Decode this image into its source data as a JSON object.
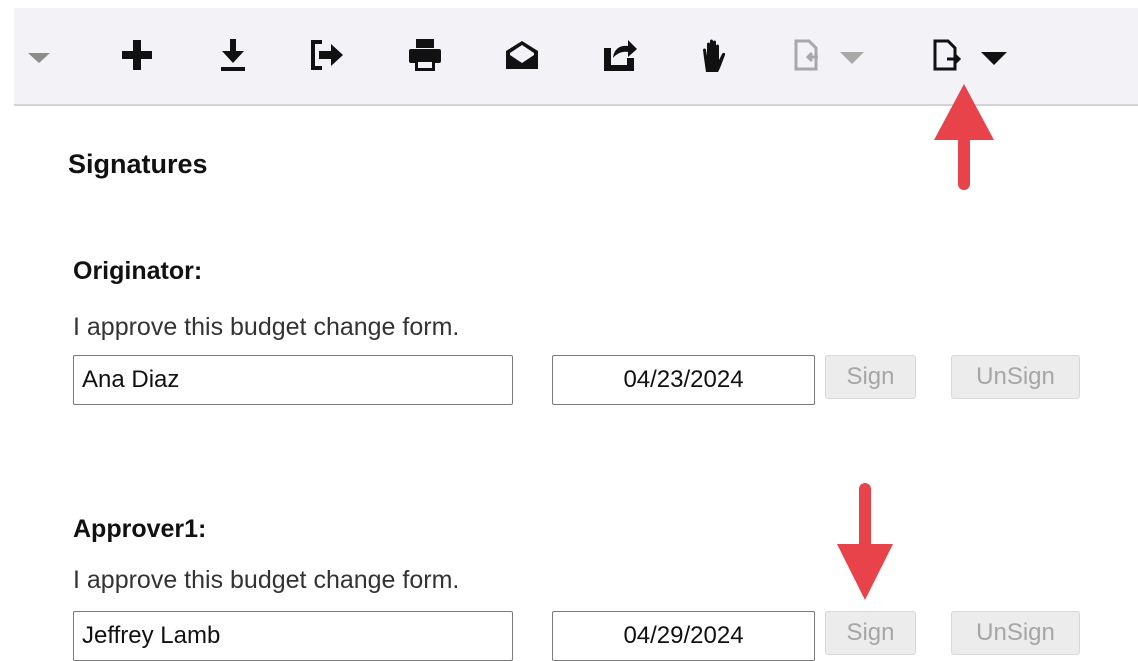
{
  "toolbar": {
    "icons": [
      "caret-down-icon",
      "add-icon",
      "download-icon",
      "export-icon",
      "print-icon",
      "email-icon",
      "reload-icon",
      "hand-icon",
      "attach-dropdown-icon",
      "document-export-dropdown-icon"
    ]
  },
  "signatures": {
    "title": "Signatures",
    "originator": {
      "label": "Originator:",
      "statement": "I approve this budget change form.",
      "name": "Ana Diaz",
      "date": "04/23/2024",
      "sign_label": "Sign",
      "unsign_label": "UnSign"
    },
    "approver1": {
      "label": "Approver1:",
      "statement": "I approve this budget change form.",
      "name": "Jeffrey Lamb",
      "date": "04/29/2024",
      "sign_label": "Sign",
      "unsign_label": "UnSign"
    }
  },
  "colors": {
    "toolbar_bg": "#f3f3f7",
    "arrow": "#e8434b",
    "disabled_text": "#a6a6a6"
  }
}
